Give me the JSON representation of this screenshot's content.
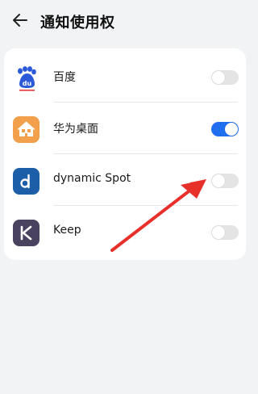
{
  "header": {
    "title": "通知使用权",
    "back_icon": "back-arrow-icon"
  },
  "apps": [
    {
      "name": "百度",
      "icon": "baidu-paw-icon",
      "enabled": false
    },
    {
      "name": "华为桌面",
      "icon": "house-icon",
      "enabled": true
    },
    {
      "name": "dynamic Spot",
      "icon": "dynamic-spot-d-icon",
      "enabled": false
    },
    {
      "name": "Keep",
      "icon": "keep-k-icon",
      "enabled": false
    }
  ],
  "colors": {
    "background": "#f1f3f5",
    "card": "#ffffff",
    "toggle_on": "#1f6ef0",
    "toggle_off": "#e4e4e4",
    "annotation_arrow": "#e8302b",
    "baidu_blue": "#2b5ad8",
    "baidu_red": "#e53935",
    "house_orange": "#f2a04b",
    "dynamic_spot_blue": "#1d5ea8",
    "keep_purple": "#4a4360"
  }
}
